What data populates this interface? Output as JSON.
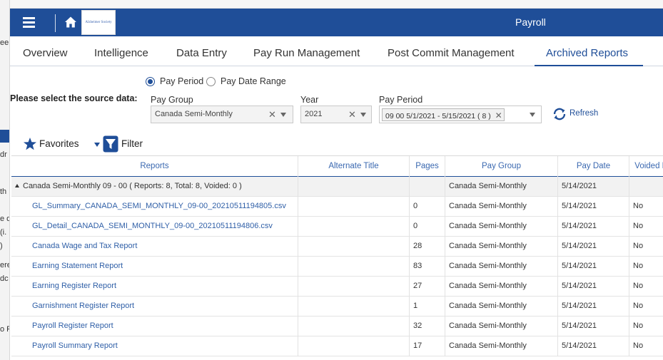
{
  "background_fragments": [
    "ee",
    "dr",
    "th",
    "e d",
    "(i.",
    ")",
    "ere",
    "dc",
    "o P"
  ],
  "header": {
    "title": "Payroll",
    "logo_text": "Alzheimer Society"
  },
  "tabs": [
    {
      "label": "Overview"
    },
    {
      "label": "Intelligence"
    },
    {
      "label": "Data Entry"
    },
    {
      "label": "Pay Run Management"
    },
    {
      "label": "Post Commit Management"
    },
    {
      "label": "Archived Reports",
      "active": true
    }
  ],
  "filters": {
    "mode_options": [
      "Pay Period",
      "Pay Date Range"
    ],
    "selected_mode": "Pay Period",
    "source_label": "Please select the source data:",
    "pay_group": {
      "label": "Pay Group",
      "value": "Canada Semi-Monthly"
    },
    "year": {
      "label": "Year",
      "value": "2021"
    },
    "pay_period": {
      "label": "Pay Period",
      "value": "09 00 5/1/2021 - 5/15/2021 ( 8 )"
    },
    "refresh_label": "Refresh"
  },
  "toolbar": {
    "favorites_label": "Favorites",
    "filter_label": "Filter"
  },
  "grid": {
    "columns": [
      "Reports",
      "Alternate Title",
      "Pages",
      "Pay Group",
      "Pay Date",
      "Voided F"
    ],
    "group_row": {
      "label": "Canada Semi-Monthly 09 - 00 ( Reports: 8, Total: 8, Voided: 0 )",
      "pay_group": "Canada Semi-Monthly",
      "pay_date": "5/14/2021"
    },
    "rows": [
      {
        "report": "GL_Summary_CANADA_SEMI_MONTHLY_09-00_20210511194805.csv",
        "alt": "",
        "pages": "0",
        "pay_group": "Canada Semi-Monthly",
        "pay_date": "5/14/2021",
        "voided": "No"
      },
      {
        "report": "GL_Detail_CANADA_SEMI_MONTHLY_09-00_20210511194806.csv",
        "alt": "",
        "pages": "0",
        "pay_group": "Canada Semi-Monthly",
        "pay_date": "5/14/2021",
        "voided": "No"
      },
      {
        "report": "Canada Wage and Tax Report",
        "alt": "",
        "pages": "28",
        "pay_group": "Canada Semi-Monthly",
        "pay_date": "5/14/2021",
        "voided": "No"
      },
      {
        "report": "Earning Statement Report",
        "alt": "",
        "pages": "83",
        "pay_group": "Canada Semi-Monthly",
        "pay_date": "5/14/2021",
        "voided": "No"
      },
      {
        "report": "Earning Register Report",
        "alt": "",
        "pages": "27",
        "pay_group": "Canada Semi-Monthly",
        "pay_date": "5/14/2021",
        "voided": "No"
      },
      {
        "report": "Garnishment Register Report",
        "alt": "",
        "pages": "1",
        "pay_group": "Canada Semi-Monthly",
        "pay_date": "5/14/2021",
        "voided": "No"
      },
      {
        "report": "Payroll Register Report",
        "alt": "",
        "pages": "32",
        "pay_group": "Canada Semi-Monthly",
        "pay_date": "5/14/2021",
        "voided": "No"
      },
      {
        "report": "Payroll Summary Report",
        "alt": "",
        "pages": "17",
        "pay_group": "Canada Semi-Monthly",
        "pay_date": "5/14/2021",
        "voided": "No"
      }
    ]
  },
  "colors": {
    "brand": "#1f4e98",
    "link": "#2f5fa7",
    "header_text": "#3a68b0"
  },
  "icons": [
    "hamburger-menu-icon",
    "home-icon",
    "refresh-icon",
    "star-icon",
    "filter-icon",
    "clear-x-icon",
    "chevron-down-icon"
  ]
}
